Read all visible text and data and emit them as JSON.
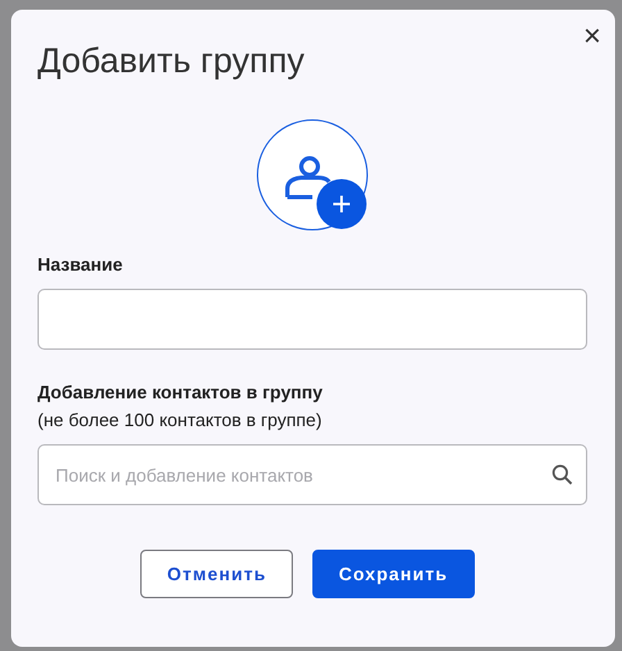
{
  "dialog": {
    "title": "Добавить группу",
    "close": "×"
  },
  "name_field": {
    "label": "Название"
  },
  "contacts_field": {
    "label": "Добавление контактов в группу",
    "hint": "(не более 100 контактов в группе)",
    "placeholder": "Поиск и добавление контактов"
  },
  "buttons": [
    {
      "label": "Отменить",
      "kind": "outlined"
    },
    {
      "label": "Сохранить",
      "kind": "filled"
    }
  ]
}
